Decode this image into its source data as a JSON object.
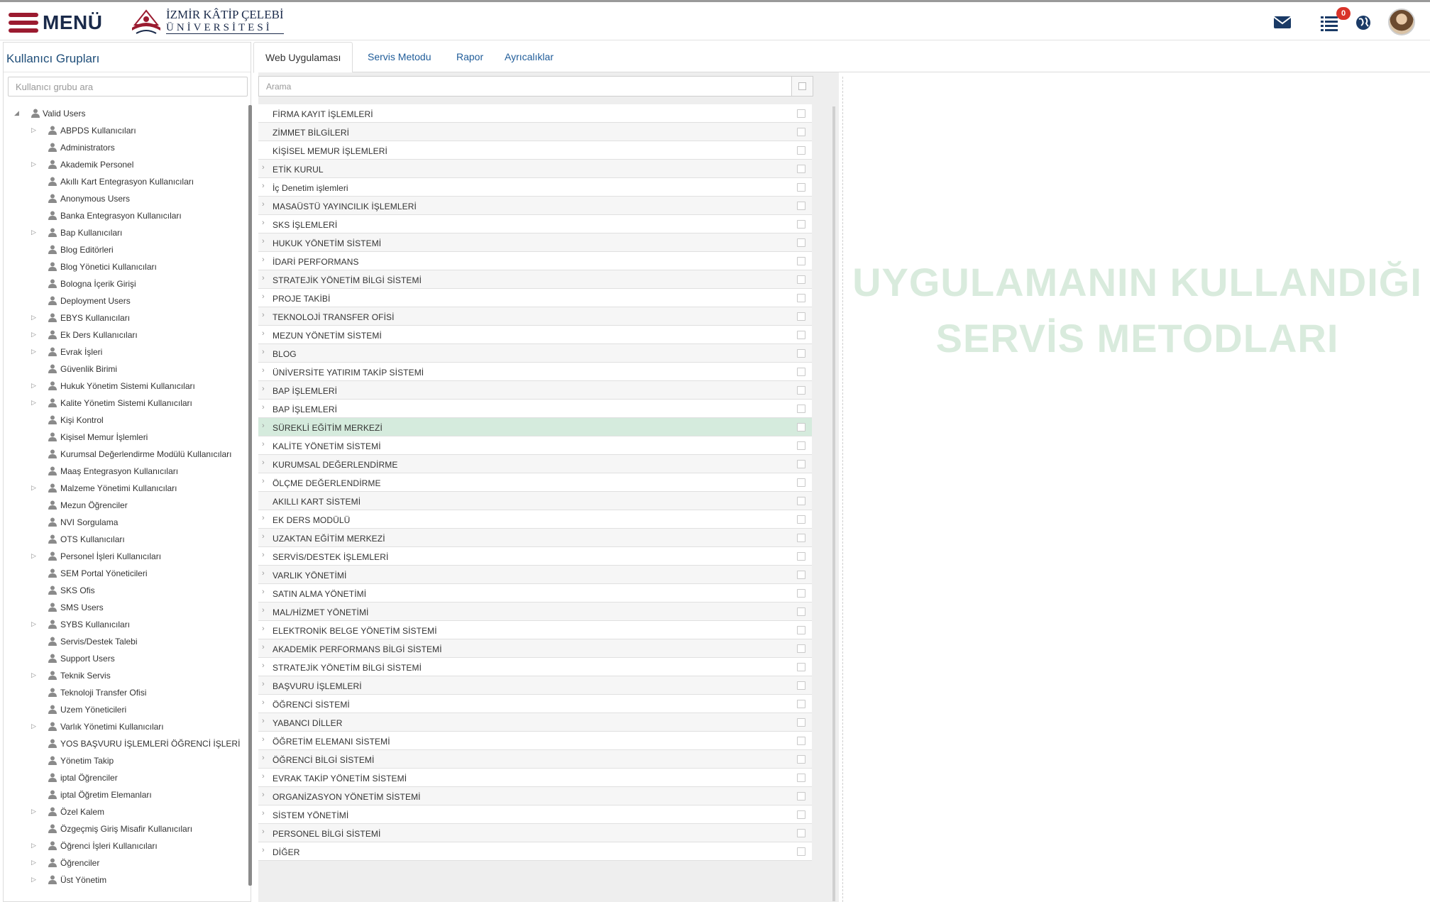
{
  "header": {
    "menu_label": "MENÜ",
    "logo_line1": "İZMİR KÂTİP ÇELEBİ",
    "logo_line2": "ÜNİVERSİTESİ",
    "notification_count": "0"
  },
  "left_panel": {
    "title": "Kullanıcı Grupları",
    "search_placeholder": "Kullanıcı grubu ara",
    "root": {
      "label": "Valid Users",
      "expanded": true
    },
    "groups": [
      {
        "label": "ABPDS Kullanıcıları",
        "expandable": true
      },
      {
        "label": "Administrators",
        "expandable": false
      },
      {
        "label": "Akademik Personel",
        "expandable": true
      },
      {
        "label": "Akıllı Kart Entegrasyon Kullanıcıları",
        "expandable": false
      },
      {
        "label": "Anonymous Users",
        "expandable": false
      },
      {
        "label": "Banka Entegrasyon Kullanıcıları",
        "expandable": false
      },
      {
        "label": "Bap Kullanıcıları",
        "expandable": true
      },
      {
        "label": "Blog Editörleri",
        "expandable": false
      },
      {
        "label": "Blog Yönetici Kullanıcıları",
        "expandable": false
      },
      {
        "label": "Bologna İçerik Girişi",
        "expandable": false
      },
      {
        "label": "Deployment Users",
        "expandable": false
      },
      {
        "label": "EBYS Kullanıcıları",
        "expandable": true
      },
      {
        "label": "Ek Ders Kullanıcıları",
        "expandable": true
      },
      {
        "label": "Evrak İşleri",
        "expandable": true
      },
      {
        "label": "Güvenlik Birimi",
        "expandable": false
      },
      {
        "label": "Hukuk Yönetim Sistemi Kullanıcıları",
        "expandable": true
      },
      {
        "label": "Kalite Yönetim Sistemi Kullanıcıları",
        "expandable": true
      },
      {
        "label": "Kişi Kontrol",
        "expandable": false
      },
      {
        "label": "Kişisel Memur İşlemleri",
        "expandable": false
      },
      {
        "label": "Kurumsal Değerlendirme Modülü Kullanıcıları",
        "expandable": false
      },
      {
        "label": "Maaş Entegrasyon Kullanıcıları",
        "expandable": false
      },
      {
        "label": "Malzeme Yönetimi Kullanıcıları",
        "expandable": true
      },
      {
        "label": "Mezun Öğrenciler",
        "expandable": false
      },
      {
        "label": "NVI Sorgulama",
        "expandable": false
      },
      {
        "label": "OTS Kullanıcıları",
        "expandable": false
      },
      {
        "label": "Personel İşleri Kullanıcıları",
        "expandable": true
      },
      {
        "label": "SEM Portal Yöneticileri",
        "expandable": false
      },
      {
        "label": "SKS Ofis",
        "expandable": false
      },
      {
        "label": "SMS Users",
        "expandable": false
      },
      {
        "label": "SYBS Kullanıcıları",
        "expandable": true
      },
      {
        "label": "Servis/Destek Talebi",
        "expandable": false
      },
      {
        "label": "Support Users",
        "expandable": false
      },
      {
        "label": "Teknik Servis",
        "expandable": true
      },
      {
        "label": "Teknoloji Transfer Ofisi",
        "expandable": false
      },
      {
        "label": "Uzem Yöneticileri",
        "expandable": false
      },
      {
        "label": "Varlık Yönetimi Kullanıcıları",
        "expandable": true
      },
      {
        "label": "YOS BAŞVURU İŞLEMLERİ ÖĞRENCİ İŞLERİ",
        "expandable": false
      },
      {
        "label": "Yönetim Takip",
        "expandable": false
      },
      {
        "label": "iptal Öğrenciler",
        "expandable": false
      },
      {
        "label": "iptal Öğretim Elemanları",
        "expandable": false
      },
      {
        "label": "Özel Kalem",
        "expandable": true
      },
      {
        "label": "Özgeçmiş Giriş Misafir Kullanıcıları",
        "expandable": false
      },
      {
        "label": "Öğrenci İşleri Kullanıcıları",
        "expandable": true
      },
      {
        "label": "Öğrenciler",
        "expandable": true
      },
      {
        "label": "Üst Yönetim",
        "expandable": true
      }
    ]
  },
  "tabs": [
    {
      "label": "Web Uygulaması",
      "active": true
    },
    {
      "label": "Servis Metodu",
      "active": false
    },
    {
      "label": "Rapor",
      "active": false
    },
    {
      "label": "Ayrıcalıklar",
      "active": false
    }
  ],
  "applications": {
    "search_placeholder": "Arama",
    "items": [
      {
        "label": "FİRMA KAYIT İŞLEMLERİ",
        "expandable": false,
        "selected": false
      },
      {
        "label": "ZİMMET BİLGİLERİ",
        "expandable": false,
        "selected": false
      },
      {
        "label": "KİŞİSEL MEMUR İŞLEMLERİ",
        "expandable": false,
        "selected": false
      },
      {
        "label": "ETİK KURUL",
        "expandable": true,
        "selected": false
      },
      {
        "label": "İç Denetim işlemleri",
        "expandable": true,
        "selected": false
      },
      {
        "label": "MASAÜSTÜ YAYINCILIK İŞLEMLERİ",
        "expandable": true,
        "selected": false
      },
      {
        "label": "SKS İŞLEMLERİ",
        "expandable": true,
        "selected": false
      },
      {
        "label": "HUKUK YÖNETİM SİSTEMİ",
        "expandable": true,
        "selected": false
      },
      {
        "label": "İDARİ PERFORMANS",
        "expandable": true,
        "selected": false
      },
      {
        "label": "STRATEJİK YÖNETİM BİLGİ SİSTEMİ",
        "expandable": true,
        "selected": false
      },
      {
        "label": "PROJE TAKİBİ",
        "expandable": true,
        "selected": false
      },
      {
        "label": "TEKNOLOJİ TRANSFER OFİSİ",
        "expandable": true,
        "selected": false
      },
      {
        "label": "MEZUN YÖNETİM SİSTEMİ",
        "expandable": true,
        "selected": false
      },
      {
        "label": "BLOG",
        "expandable": true,
        "selected": false
      },
      {
        "label": "ÜNİVERSİTE YATIRIM TAKİP SİSTEMİ",
        "expandable": true,
        "selected": false
      },
      {
        "label": "BAP İŞLEMLERİ",
        "expandable": true,
        "selected": false
      },
      {
        "label": "BAP İŞLEMLERİ",
        "expandable": true,
        "selected": false
      },
      {
        "label": "SÜREKLİ EĞİTİM MERKEZİ",
        "expandable": true,
        "selected": true
      },
      {
        "label": "KALİTE YÖNETİM SİSTEMİ",
        "expandable": true,
        "selected": false
      },
      {
        "label": "KURUMSAL DEĞERLENDİRME",
        "expandable": true,
        "selected": false
      },
      {
        "label": "ÖLÇME DEĞERLENDİRME",
        "expandable": true,
        "selected": false
      },
      {
        "label": "AKILLI KART SİSTEMİ",
        "expandable": false,
        "selected": false
      },
      {
        "label": "EK DERS MODÜLÜ",
        "expandable": true,
        "selected": false
      },
      {
        "label": "UZAKTAN EĞİTİM MERKEZİ",
        "expandable": true,
        "selected": false
      },
      {
        "label": "SERVİS/DESTEK İŞLEMLERİ",
        "expandable": true,
        "selected": false
      },
      {
        "label": "VARLIK YÖNETİMİ",
        "expandable": true,
        "selected": false
      },
      {
        "label": "SATIN ALMA YÖNETİMİ",
        "expandable": true,
        "selected": false
      },
      {
        "label": "MAL/HİZMET YÖNETİMİ",
        "expandable": true,
        "selected": false
      },
      {
        "label": "ELEKTRONİK BELGE YÖNETİM SİSTEMİ",
        "expandable": true,
        "selected": false
      },
      {
        "label": "AKADEMİK PERFORMANS BİLGİ SİSTEMİ",
        "expandable": true,
        "selected": false
      },
      {
        "label": "STRATEJİK YÖNETİM BİLGİ SİSTEMİ",
        "expandable": true,
        "selected": false
      },
      {
        "label": "BAŞVURU İŞLEMLERİ",
        "expandable": true,
        "selected": false
      },
      {
        "label": "ÖĞRENCİ SİSTEMİ",
        "expandable": true,
        "selected": false
      },
      {
        "label": "YABANCI DİLLER",
        "expandable": true,
        "selected": false
      },
      {
        "label": "ÖĞRETİM ELEMANI SİSTEMİ",
        "expandable": true,
        "selected": false
      },
      {
        "label": "ÖĞRENCİ BİLGİ SİSTEMİ",
        "expandable": true,
        "selected": false
      },
      {
        "label": "EVRAK TAKİP YÖNETİM SİSTEMİ",
        "expandable": true,
        "selected": false
      },
      {
        "label": "ORGANİZASYON YÖNETİM SİSTEMİ",
        "expandable": true,
        "selected": false
      },
      {
        "label": "SİSTEM YÖNETİMİ",
        "expandable": true,
        "selected": false
      },
      {
        "label": "PERSONEL BİLGİ SİSTEMİ",
        "expandable": true,
        "selected": false
      },
      {
        "label": "DİĞER",
        "expandable": true,
        "selected": false
      }
    ]
  },
  "watermark": {
    "line1": "UYGULAMANIN KULLANDIĞI",
    "line2": "SERVİS METODLARI"
  },
  "colors": {
    "brand_red": "#9b1b30",
    "link_blue": "#1f5c99",
    "selected_row": "#d5ebdd",
    "watermark": "#d9ebdd"
  },
  "icons": {
    "menu": "hamburger-icon",
    "mail": "envelope-icon",
    "tasks": "task-list-icon",
    "language": "globe-icon",
    "user": "user-icon"
  }
}
